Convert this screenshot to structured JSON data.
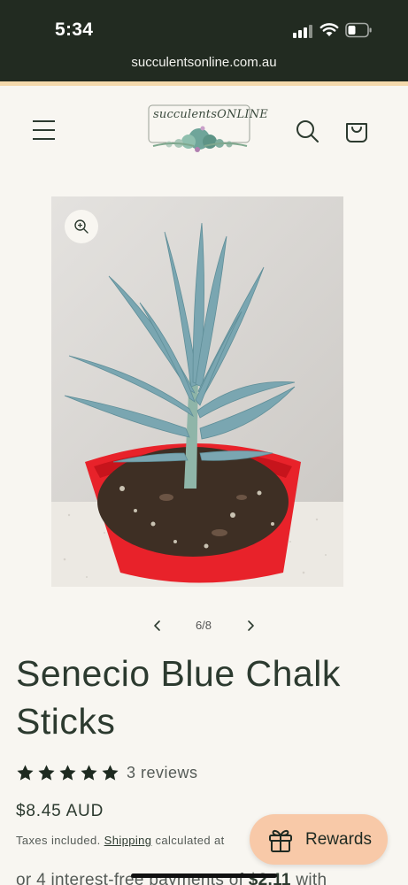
{
  "status_bar": {
    "time": "5:34"
  },
  "browser": {
    "url": "succulentsonline.com.au"
  },
  "header": {
    "logo_text": "succulentsONLINE"
  },
  "gallery": {
    "counter": "6/8"
  },
  "product": {
    "title": "Senecio Blue Chalk Sticks",
    "rating_stars": 5,
    "reviews": "3 reviews",
    "price": "$8.45 AUD",
    "taxes_prefix": "Taxes included.",
    "shipping_link": "Shipping",
    "taxes_suffix": "calculated at"
  },
  "afterpay": {
    "prefix": "or 4 interest-free payments of",
    "amount": "$2.11",
    "suffix": "with"
  },
  "rewards": {
    "label": "Rewards"
  },
  "colors": {
    "brand_dark": "#222b21",
    "accent_line": "#f4d9ac",
    "rewards_bg": "#f8c9a8",
    "pot_red": "#e8222a"
  }
}
